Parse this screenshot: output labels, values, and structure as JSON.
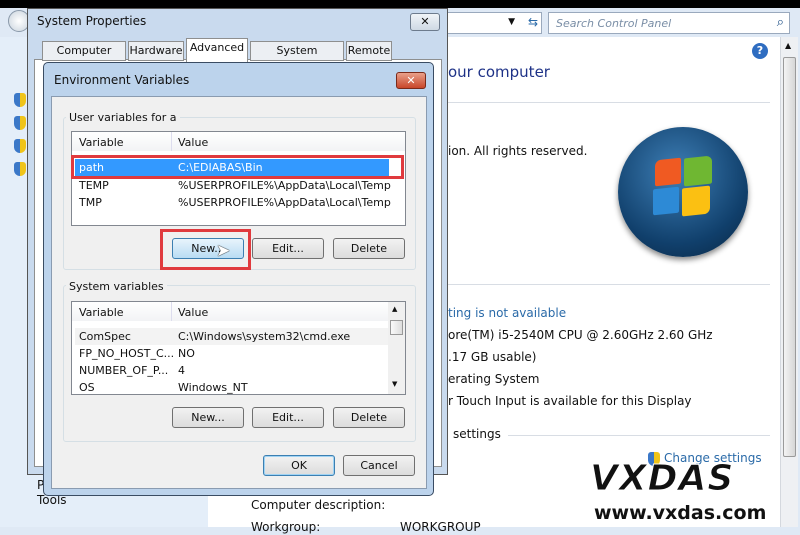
{
  "control_panel": {
    "search_placeholder": "Search Control Panel",
    "heading_partial": "our computer",
    "copyright_partial": "ion.  All rights reserved.",
    "rating_link": "ting is not available",
    "processor": "ore(TM) i5-2540M CPU @ 2.60GHz   2.60 GHz",
    "memory": ".17 GB usable)",
    "system_type": "erating System",
    "pen_touch": "r Touch Input is available for this Display",
    "settings_section": "settings",
    "change_settings": "Change settings",
    "nav_p": "P",
    "nav_tools": "Tools",
    "computer_description_label": "Computer description:",
    "workgroup_label": "Workgroup:",
    "workgroup_value": "WORKGROUP"
  },
  "system_properties": {
    "title": "System Properties",
    "tabs": [
      "Computer Name",
      "Hardware",
      "Advanced",
      "System Protection",
      "Remote"
    ],
    "active_tab": "Advanced"
  },
  "env_vars": {
    "title": "Environment Variables",
    "user_group_label": "User variables for a",
    "columns": [
      "Variable",
      "Value"
    ],
    "user_vars": [
      {
        "name": "path",
        "value": "C:\\EDIABAS\\Bin",
        "selected": true
      },
      {
        "name": "TEMP",
        "value": "%USERPROFILE%\\AppData\\Local\\Temp"
      },
      {
        "name": "TMP",
        "value": "%USERPROFILE%\\AppData\\Local\\Temp"
      }
    ],
    "system_group_label": "System variables",
    "system_vars": [
      {
        "name": "ComSpec",
        "value": "C:\\Windows\\system32\\cmd.exe"
      },
      {
        "name": "FP_NO_HOST_C...",
        "value": "NO"
      },
      {
        "name": "NUMBER_OF_P...",
        "value": "4"
      },
      {
        "name": "OS",
        "value": "Windows_NT"
      }
    ],
    "new_label": "New...",
    "edit_label": "Edit...",
    "delete_label": "Delete",
    "ok_label": "OK",
    "cancel_label": "Cancel"
  },
  "watermark": {
    "brand": "VXDAS",
    "url": "www.vxdas.com"
  },
  "colors": {
    "highlight": "#3399ff",
    "annotation_red": "#e03a3e",
    "link": "#2a6aa8"
  }
}
